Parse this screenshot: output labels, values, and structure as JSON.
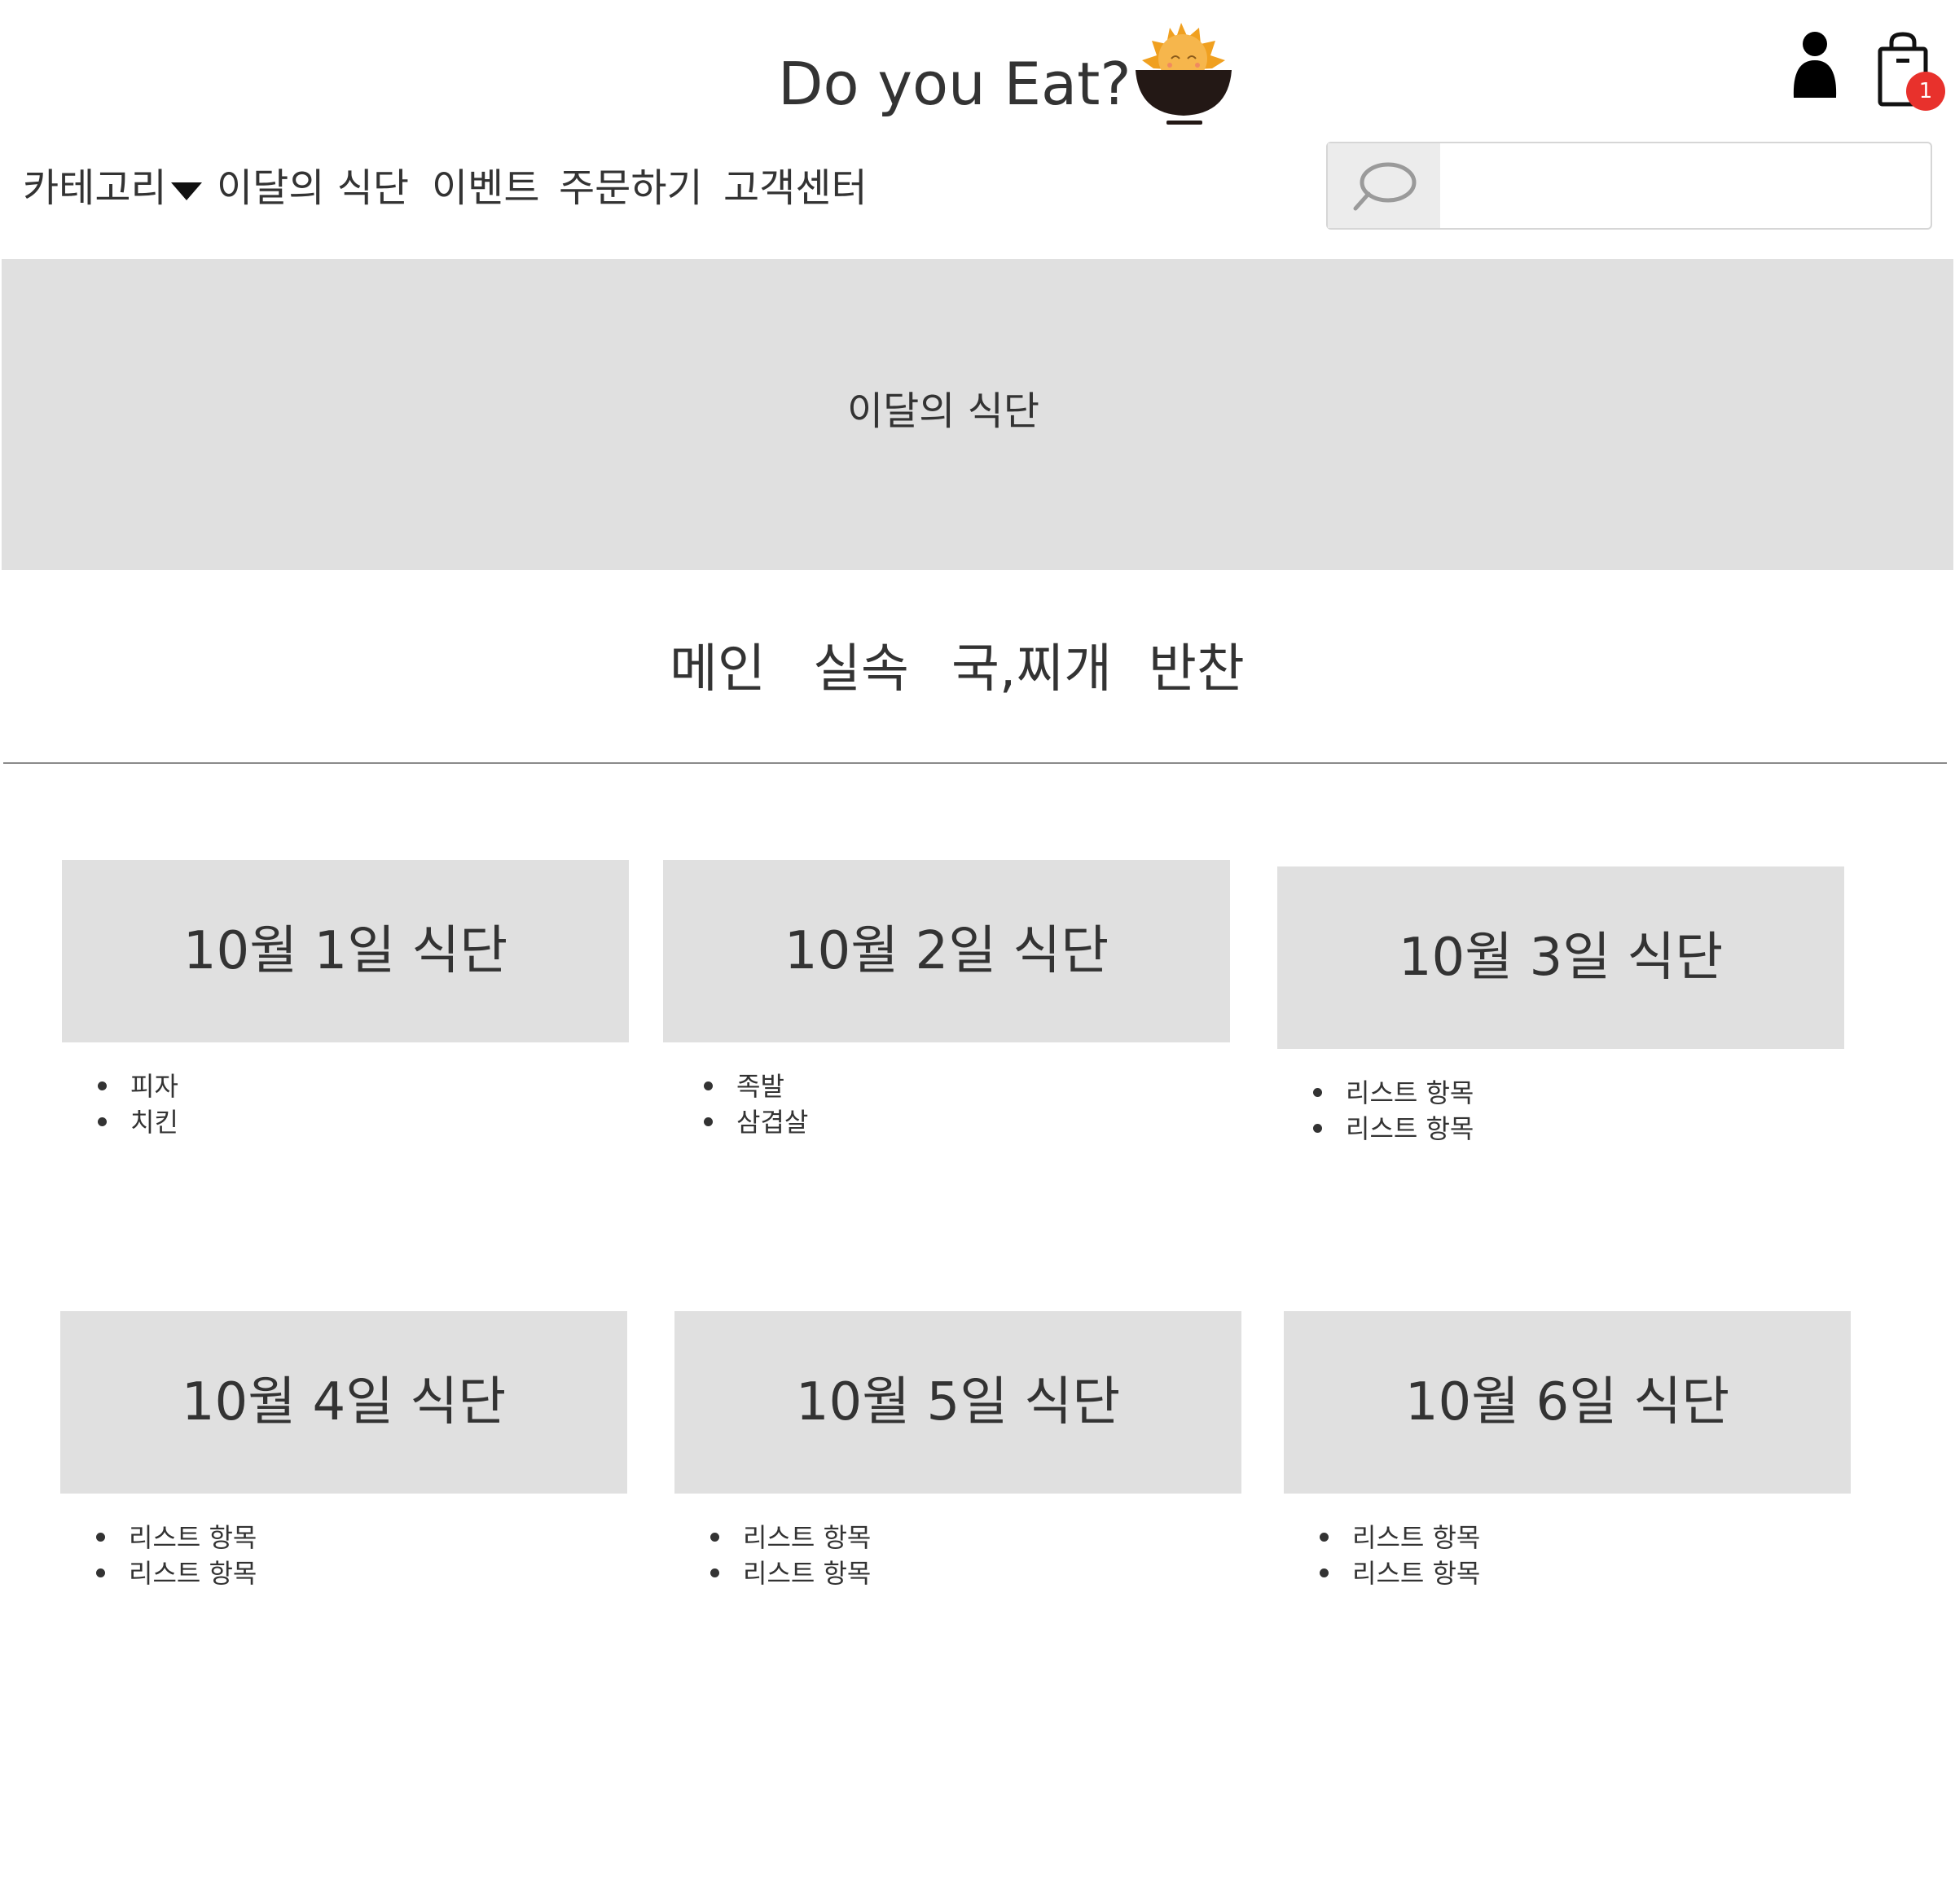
{
  "header": {
    "brand_title": "Do you Eat?",
    "cart_count": "1"
  },
  "nav": {
    "category": "카테고리",
    "monthly_menu": "이달의 식단",
    "event": "이벤트",
    "order": "주문하기",
    "support": "고객센터"
  },
  "search": {
    "value": "",
    "placeholder": ""
  },
  "banner": {
    "text": "이달의 식단"
  },
  "tabs": [
    {
      "label": "메인"
    },
    {
      "label": "실속"
    },
    {
      "label": "국,찌개"
    },
    {
      "label": "반찬"
    }
  ],
  "cards": [
    {
      "title": "10월 1일 식단",
      "items": [
        "피자",
        "치킨"
      ]
    },
    {
      "title": "10월 2일 식단",
      "items": [
        "족발",
        "삼겹살"
      ]
    },
    {
      "title": "10월 3일 식단",
      "items": [
        "리스트 항목",
        "리스트 항목"
      ]
    },
    {
      "title": "10월 4일 식단",
      "items": [
        "리스트 항목",
        "리스트 항목"
      ]
    },
    {
      "title": "10월 5일 식단",
      "items": [
        "리스트 항목",
        "리스트 항목"
      ]
    },
    {
      "title": "10월 6일 식단",
      "items": [
        "리스트 항목",
        "리스트 항목"
      ]
    }
  ],
  "colors": {
    "badge": "#e8312c",
    "panel": "#e0e0e0",
    "text": "#333333",
    "logo_sun": "#f0a020",
    "logo_bowl": "#231815"
  },
  "icons": {
    "logo": "sun-rice-bowl-logo",
    "user": "user-icon",
    "cart": "shopping-bag-icon",
    "search": "search-icon",
    "caret": "caret-down-icon"
  }
}
